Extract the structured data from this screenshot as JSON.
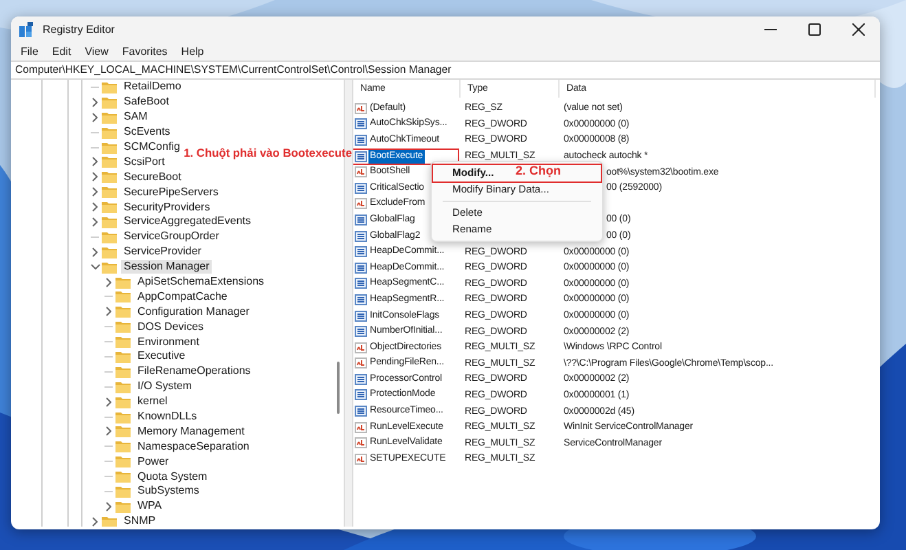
{
  "window": {
    "title": "Registry Editor"
  },
  "menu": [
    "File",
    "Edit",
    "View",
    "Favorites",
    "Help"
  ],
  "address": "Computer\\HKEY_LOCAL_MACHINE\\SYSTEM\\CurrentControlSet\\Control\\Session Manager",
  "tree": [
    {
      "label": "RetailDemo",
      "selected": false
    },
    {
      "label": "SafeBoot",
      "expanded": false,
      "selected": false
    },
    {
      "label": "SAM",
      "expanded": false,
      "selected": false
    },
    {
      "label": "ScEvents",
      "selected": false
    },
    {
      "label": "SCMConfig",
      "selected": false
    },
    {
      "label": "ScsiPort",
      "expanded": false,
      "selected": false
    },
    {
      "label": "SecureBoot",
      "expanded": false,
      "selected": false
    },
    {
      "label": "SecurePipeServers",
      "expanded": false,
      "selected": false
    },
    {
      "label": "SecurityProviders",
      "expanded": false,
      "selected": false
    },
    {
      "label": "ServiceAggregatedEvents",
      "expanded": false,
      "selected": false
    },
    {
      "label": "ServiceGroupOrder",
      "selected": false
    },
    {
      "label": "ServiceProvider",
      "expanded": false,
      "selected": false
    },
    {
      "label": "Session Manager",
      "expanded": true,
      "selected": true,
      "children": [
        {
          "label": "ApiSetSchemaExtensions",
          "expanded": false,
          "selected": false
        },
        {
          "label": "AppCompatCache",
          "selected": false
        },
        {
          "label": "Configuration Manager",
          "expanded": false,
          "selected": false
        },
        {
          "label": "DOS Devices",
          "selected": false
        },
        {
          "label": "Environment",
          "selected": false
        },
        {
          "label": "Executive",
          "selected": false
        },
        {
          "label": "FileRenameOperations",
          "selected": false
        },
        {
          "label": "I/O System",
          "selected": false
        },
        {
          "label": "kernel",
          "expanded": false,
          "selected": false
        },
        {
          "label": "KnownDLLs",
          "selected": false
        },
        {
          "label": "Memory Management",
          "expanded": false,
          "selected": false
        },
        {
          "label": "NamespaceSeparation",
          "selected": false
        },
        {
          "label": "Power",
          "selected": false
        },
        {
          "label": "Quota System",
          "selected": false
        },
        {
          "label": "SubSystems",
          "selected": false
        },
        {
          "label": "WPA",
          "expanded": false,
          "selected": false
        }
      ]
    },
    {
      "label": "SNMP",
      "expanded": false,
      "selected": false
    }
  ],
  "columns": [
    "Name",
    "Type",
    "Data"
  ],
  "rows": [
    {
      "kind": "string",
      "name": "(Default)",
      "type": "REG_SZ",
      "data": "(value not set)",
      "selected": false,
      "marked": false
    },
    {
      "kind": "number",
      "name": "AutoChkSkipSys...",
      "type": "REG_DWORD",
      "data": "0x00000000 (0)",
      "selected": false,
      "marked": false
    },
    {
      "kind": "number",
      "name": "AutoChkTimeout",
      "type": "REG_DWORD",
      "data": "0x00000008 (8)",
      "selected": false,
      "marked": false
    },
    {
      "kind": "number",
      "name": "BootExecute",
      "type": "REG_MULTI_SZ",
      "data": "autocheck autochk *",
      "selected": true,
      "marked": true
    },
    {
      "kind": "string",
      "name": "BootShell",
      "data": "oot%\\system32\\bootim.exe",
      "selected": false,
      "marked": false
    },
    {
      "kind": "number",
      "name": "CriticalSectio",
      "data": "00 (2592000)",
      "selected": false,
      "marked": false
    },
    {
      "kind": "string",
      "name": "ExcludeFrom",
      "selected": false,
      "marked": false
    },
    {
      "kind": "number",
      "name": "GlobalFlag",
      "data": "00 (0)",
      "selected": false,
      "marked": false
    },
    {
      "kind": "number",
      "name": "GlobalFlag2",
      "data": "00 (0)",
      "selected": false,
      "marked": false
    },
    {
      "kind": "number",
      "name": "HeapDeCommit...",
      "type": "REG_DWORD",
      "data": "0x00000000 (0)",
      "selected": false,
      "marked": false
    },
    {
      "kind": "number",
      "name": "HeapDeCommit...",
      "type": "REG_DWORD",
      "data": "0x00000000 (0)",
      "selected": false,
      "marked": false
    },
    {
      "kind": "number",
      "name": "HeapSegmentC...",
      "type": "REG_DWORD",
      "data": "0x00000000 (0)",
      "selected": false,
      "marked": false
    },
    {
      "kind": "number",
      "name": "HeapSegmentR...",
      "type": "REG_DWORD",
      "data": "0x00000000 (0)",
      "selected": false,
      "marked": false
    },
    {
      "kind": "number",
      "name": "InitConsoleFlags",
      "type": "REG_DWORD",
      "data": "0x00000000 (0)",
      "selected": false,
      "marked": false
    },
    {
      "kind": "number",
      "name": "NumberOfInitial...",
      "type": "REG_DWORD",
      "data": "0x00000002 (2)",
      "selected": false,
      "marked": false
    },
    {
      "kind": "string",
      "name": "ObjectDirectories",
      "type": "REG_MULTI_SZ",
      "data": "\\Windows \\RPC Control",
      "selected": false,
      "marked": false
    },
    {
      "kind": "string",
      "name": "PendingFileRen...",
      "type": "REG_MULTI_SZ",
      "data": "\\??\\C:\\Program Files\\Google\\Chrome\\Temp\\scop...",
      "selected": false,
      "marked": false
    },
    {
      "kind": "number",
      "name": "ProcessorControl",
      "type": "REG_DWORD",
      "data": "0x00000002 (2)",
      "selected": false,
      "marked": false
    },
    {
      "kind": "number",
      "name": "ProtectionMode",
      "type": "REG_DWORD",
      "data": "0x00000001 (1)",
      "selected": false,
      "marked": false
    },
    {
      "kind": "number",
      "name": "ResourceTimeo...",
      "type": "REG_DWORD",
      "data": "0x0000002d (45)",
      "selected": false,
      "marked": false
    },
    {
      "kind": "string",
      "name": "RunLevelExecute",
      "type": "REG_MULTI_SZ",
      "data": "WinInit ServiceControlManager",
      "selected": false,
      "marked": false
    },
    {
      "kind": "string",
      "name": "RunLevelValidate",
      "type": "REG_MULTI_SZ",
      "data": "ServiceControlManager",
      "selected": false,
      "marked": false
    },
    {
      "kind": "string",
      "name": "SETUPEXECUTE",
      "type": "REG_MULTI_SZ",
      "selected": false,
      "marked": false
    }
  ],
  "context_menu": [
    {
      "kind": "item",
      "label": "Modify...",
      "default": true,
      "marked": true
    },
    {
      "kind": "item",
      "label": "Modify Binary Data...",
      "default": false,
      "marked": false
    },
    {
      "kind": "separator"
    },
    {
      "kind": "item",
      "label": "Delete",
      "default": false,
      "marked": false
    },
    {
      "kind": "item",
      "label": "Rename",
      "default": false,
      "marked": false
    }
  ],
  "annotations": [
    {
      "text": "1. Chuột phải vào Bootexecute"
    },
    {
      "text": "2. Chọn"
    }
  ]
}
